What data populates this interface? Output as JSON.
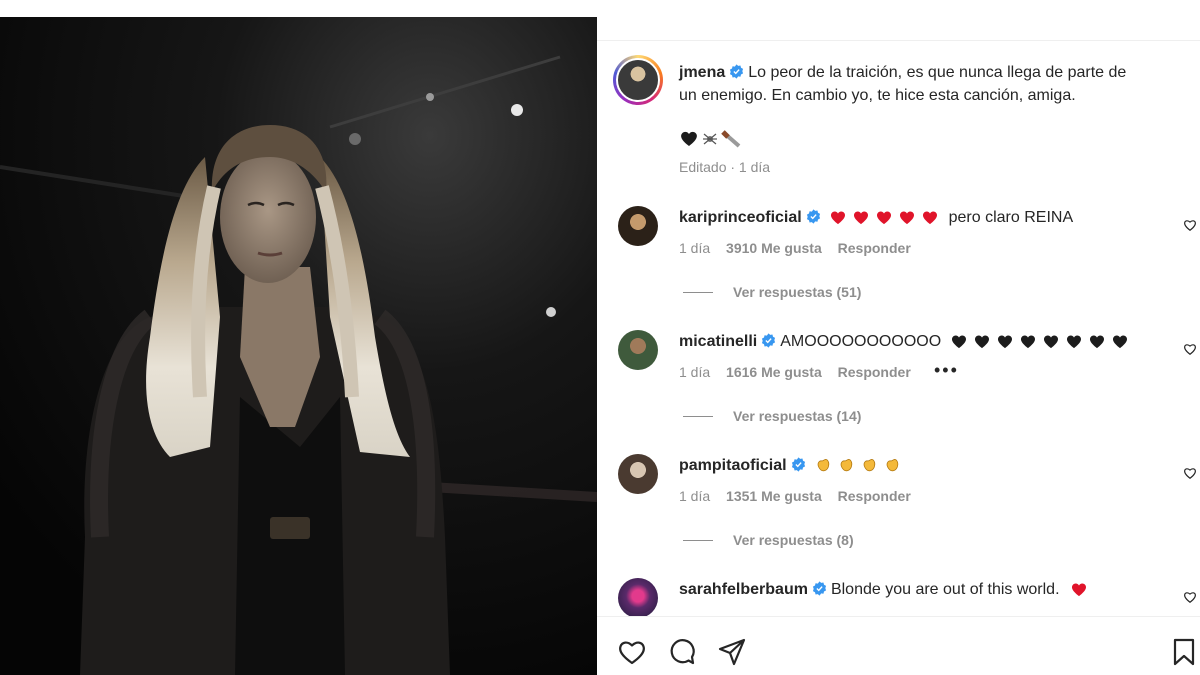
{
  "post": {
    "username": "jmena",
    "caption_line1": "Lo peor de la traición, es que nunca llega de parte de",
    "caption_line2": "un enemigo. En cambio yo, te hice esta canción, amiga.",
    "caption_emojis": "🖤🕷️🔪",
    "edited_label": "Editado · 1 día"
  },
  "comments": [
    {
      "username": "kariprinceoficial",
      "text": "pero claro REINA",
      "emoji": "red-heart",
      "emoji_count": 5,
      "time": "1 día",
      "likes": "3910 Me gusta",
      "reply": "Responder",
      "view_replies": "Ver respuestas (51)"
    },
    {
      "username": "micatinelli",
      "text": "AMOOOOOOOOOOO",
      "emoji": "black-heart",
      "emoji_count": 8,
      "time": "1 día",
      "likes": "1616 Me gusta",
      "reply": "Responder",
      "more": "•••",
      "view_replies": "Ver respuestas (14)"
    },
    {
      "username": "pampitaoficial",
      "text": "",
      "emoji": "clapping-hands",
      "emoji_count": 4,
      "time": "1 día",
      "likes": "1351 Me gusta",
      "reply": "Responder",
      "view_replies": "Ver respuestas (8)"
    },
    {
      "username": "sarahfelberbaum",
      "text": "Blonde you are out of this world.",
      "emoji": "red-heart",
      "emoji_count": 1
    }
  ],
  "icons": {
    "like": "heart-icon",
    "comment": "comment-icon",
    "share": "send-icon",
    "save": "bookmark-icon",
    "verified": "verified-badge-icon"
  },
  "colors": {
    "verified": "#3897f0",
    "red_heart": "#e0142a",
    "black_heart": "#1c1c1c",
    "clap": "#f4b93a",
    "muted_text": "#8e8e8e"
  }
}
